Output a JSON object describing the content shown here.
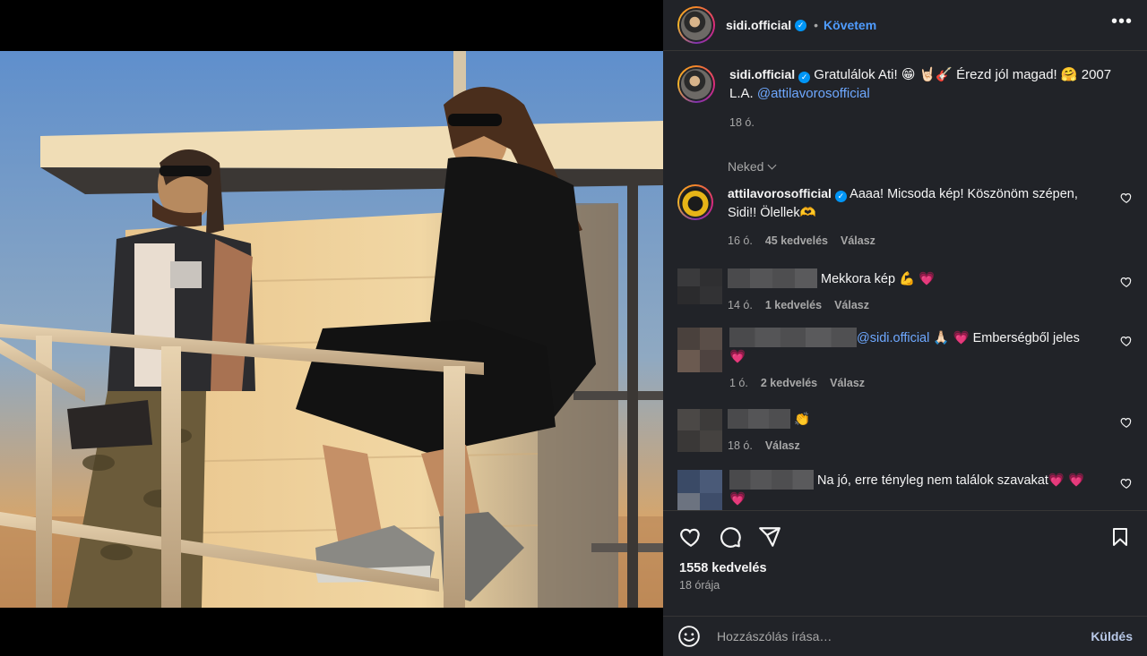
{
  "header": {
    "username": "sidi.official",
    "follow_label": "Követem",
    "more_label": "•••"
  },
  "caption": {
    "username": "sidi.official",
    "text": "Gratulálok Ati! 😁 🤘🏻🎸 Érezd jól magad! 🤗 2007 L.A.",
    "mention": "@attilavorosofficial",
    "time": "18 ó."
  },
  "sort_label": "Neked",
  "comments": [
    {
      "username": "attilavorosofficial",
      "text": "Aaaa! Micsoda kép! Köszönöm szépen, Sidi!! Ölellek🫶",
      "time": "16 ó.",
      "likes": "45 kedvelés",
      "reply": "Válasz"
    },
    {
      "text": "Mekkora kép 💪",
      "heart": "💗",
      "time": "14 ó.",
      "likes": "1 kedvelés",
      "reply": "Válasz"
    },
    {
      "mention": "@sidi.official",
      "text_pray": "🙏🏻",
      "text": "Emberségből jeles",
      "heart": "💗",
      "time": "1 ó.",
      "likes": "2 kedvelés",
      "reply": "Válasz"
    },
    {
      "text": "👏",
      "time": "18 ó.",
      "reply": "Válasz"
    },
    {
      "text": "Na jó, erre tényleg nem találok szavakat💗 💗 💗",
      "hearts": "💗 💗 💗 💗 💗 💗 💗"
    }
  ],
  "post": {
    "likes": "1558 kedvelés",
    "time": "18 órája"
  },
  "composer": {
    "placeholder": "Hozzászólás írása…",
    "send_label": "Küldés"
  },
  "colors": {
    "panel_bg": "#212328",
    "accent_link": "#4f9cff",
    "verified": "#0095f6",
    "heart": "#ff3f7a"
  },
  "icons": [
    "verified-badge-icon",
    "more-options-icon",
    "heart-icon",
    "comment-icon",
    "share-icon",
    "bookmark-icon",
    "emoji-icon",
    "chevron-down-icon"
  ]
}
